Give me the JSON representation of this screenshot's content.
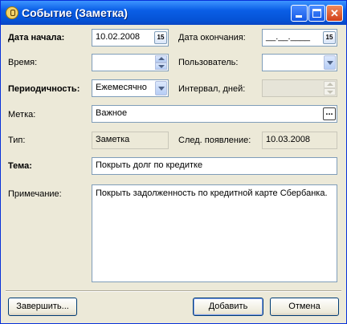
{
  "window": {
    "title": "Событие (Заметка)"
  },
  "fields": {
    "start_date": {
      "label": "Дата начала:",
      "value": "10.02.2008"
    },
    "end_date": {
      "label": "Дата окончания:",
      "value": "__.__.____"
    },
    "time": {
      "label": "Время:",
      "value": ""
    },
    "user": {
      "label": "Пользователь:",
      "value": ""
    },
    "periodicity": {
      "label": "Периодичность:",
      "value": "Ежемесячно"
    },
    "interval": {
      "label": "Интервал, дней:",
      "value": ""
    },
    "tag": {
      "label": "Метка:",
      "value": "Важное"
    },
    "type": {
      "label": "Тип:",
      "value": "Заметка"
    },
    "next": {
      "label": "След. появление:",
      "value": "10.03.2008"
    },
    "subject": {
      "label": "Тема:",
      "value": "Покрыть долг по кредитке"
    },
    "note": {
      "label": "Примечание:",
      "value": "Покрыть задолженность по кредитной карте Сбербанка."
    }
  },
  "buttons": {
    "finish": "Завершить...",
    "add": "Добавить",
    "cancel": "Отмена"
  },
  "icons": {
    "calendar_badge": "15",
    "ellipsis": "..."
  }
}
